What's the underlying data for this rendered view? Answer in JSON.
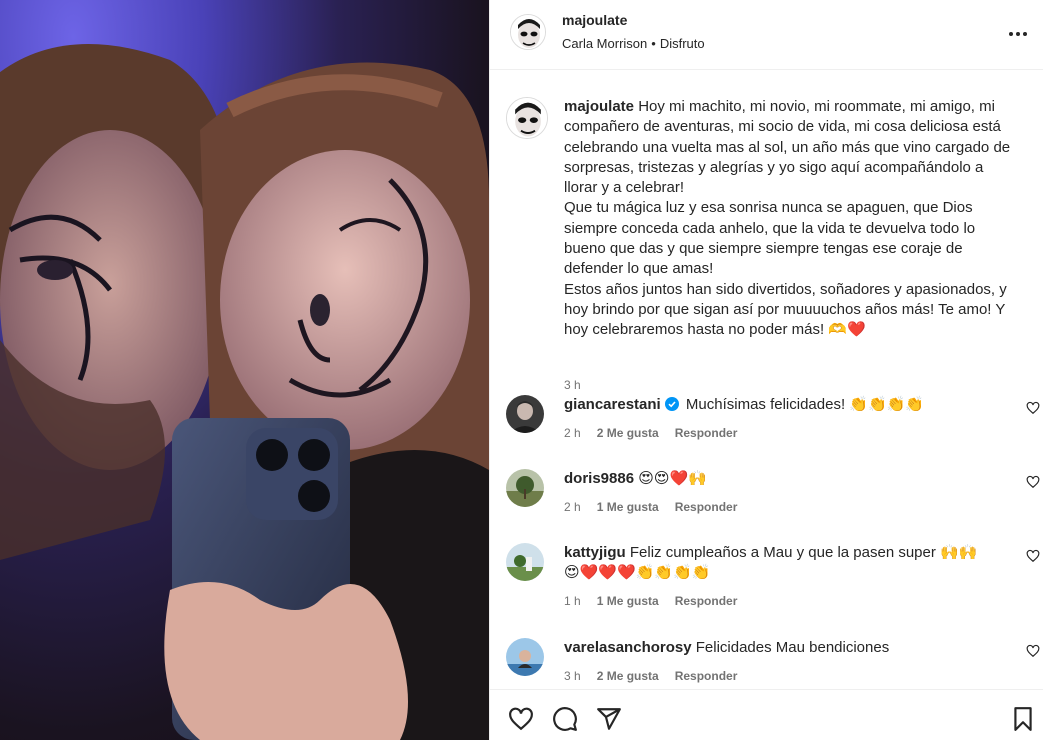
{
  "post": {
    "username": "majoulate",
    "audio_artist": "Carla Morrison",
    "audio_separator": "•",
    "audio_track": "Disfruto",
    "more_icon": "more-horizontal-icon"
  },
  "caption": {
    "username": "majoulate",
    "lines": [
      "Hoy mi machito, mi novio, mi roommate, mi amigo, mi",
      "compañero de aventuras, mi socio de vida, mi cosa deliciosa está",
      "celebrando una vuelta mas al sol, un año más que vino cargado de",
      "sorpresas, tristezas y alegrías y yo sigo aquí acompañándolo a",
      "llorar y a celebrar!",
      "Que tu mágica luz y esa sonrisa nunca se apaguen, que Dios",
      "siempre conceda cada anhelo, que la vida te devuelva todo lo",
      "bueno que das y que siempre siempre tengas ese coraje de",
      "defender lo que amas!",
      "Estos años juntos han sido divertidos, soñadores y apasionados, y",
      "hoy brindo por que sigan así por muuuuchos años más! Te amo! Y",
      "hoy celebraremos hasta no poder más! 🫶❤️"
    ],
    "time": "3 h"
  },
  "comments": [
    {
      "username": "giancarestani",
      "verified": true,
      "text": "Muchísimas felicidades! 👏👏👏👏",
      "time": "2 h",
      "likes": "2 Me gusta",
      "reply": "Responder"
    },
    {
      "username": "doris9886",
      "verified": false,
      "text": "😍😍❤️🙌",
      "time": "2 h",
      "likes": "1 Me gusta",
      "reply": "Responder"
    },
    {
      "username": "kattyjigu",
      "verified": false,
      "text": "Feliz cumpleaños a Mau y que la pasen super 🙌🙌",
      "text2": "😍❤️❤️❤️👏👏👏👏",
      "time": "1 h",
      "likes": "1 Me gusta",
      "reply": "Responder"
    },
    {
      "username": "varelasanchorosy",
      "verified": false,
      "text": "Felicidades Mau bendiciones",
      "time": "3 h",
      "likes": "2 Me gusta",
      "reply": "Responder"
    }
  ],
  "actions": {
    "like_icon": "heart-icon",
    "comment_icon": "comment-icon",
    "share_icon": "send-icon",
    "save_icon": "bookmark-icon"
  },
  "colors": {
    "text": "#262626",
    "secondary": "#737373",
    "verified": "#0095f6",
    "border": "#efefef"
  }
}
